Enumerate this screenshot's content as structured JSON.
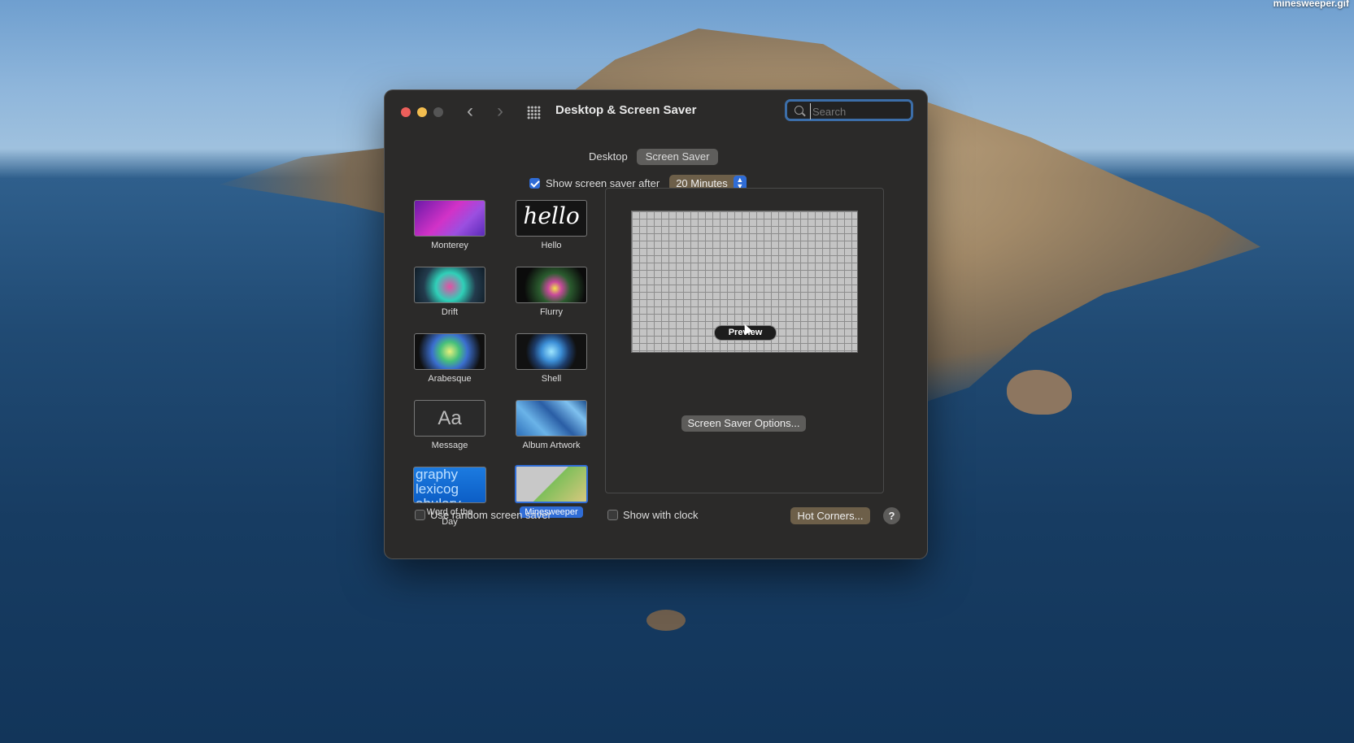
{
  "desktop": {
    "file_label": "minesweeper.gif"
  },
  "window": {
    "title": "Desktop & Screen Saver",
    "search_placeholder": "Search",
    "tabs": [
      {
        "label": "Desktop",
        "active": false
      },
      {
        "label": "Screen Saver",
        "active": true
      }
    ],
    "show_after": {
      "label": "Show screen saver after",
      "checked": true,
      "duration": "20 Minutes"
    },
    "savers": [
      {
        "name": "Monterey"
      },
      {
        "name": "Hello",
        "thumb_text": "hello"
      },
      {
        "name": "Drift"
      },
      {
        "name": "Flurry"
      },
      {
        "name": "Arabesque"
      },
      {
        "name": "Shell"
      },
      {
        "name": "Message",
        "thumb_text": "Aa"
      },
      {
        "name": "Album Artwork"
      },
      {
        "name": "Word of the Day",
        "thumb_text": "graphy lexicog abulary"
      },
      {
        "name": "Minesweeper",
        "selected": true
      }
    ],
    "preview": {
      "button_label": "Preview"
    },
    "options_button": "Screen Saver Options...",
    "random_saver": {
      "label": "Use random screen saver",
      "checked": false
    },
    "show_clock": {
      "label": "Show with clock",
      "checked": false
    },
    "hot_corners_button": "Hot Corners...",
    "help_button": "?"
  }
}
